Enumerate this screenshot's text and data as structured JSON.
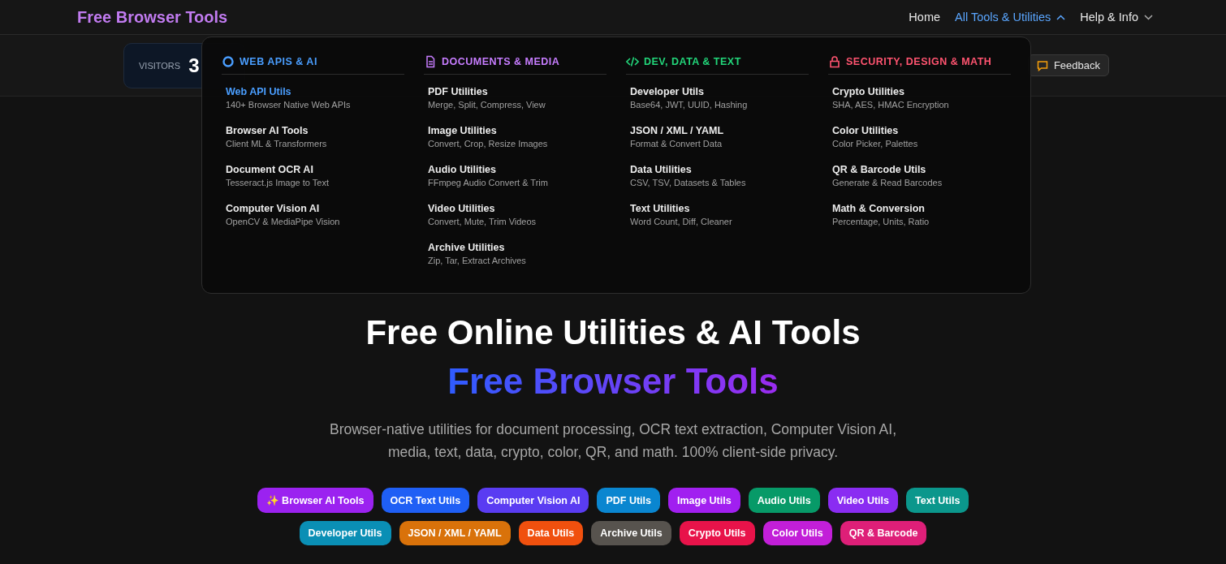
{
  "header": {
    "logo": "Free Browser Tools",
    "nav": [
      {
        "label": "Home",
        "kind": "link",
        "selected": false
      },
      {
        "label": "All Tools & Utilities",
        "kind": "dropdown",
        "selected": true,
        "expanded": true
      },
      {
        "label": "Help & Info",
        "kind": "dropdown",
        "selected": false,
        "expanded": false
      }
    ]
  },
  "stats": {
    "label": "VISITORS",
    "value": "3"
  },
  "feedback_button": "Feedback",
  "menu": {
    "sections": [
      {
        "title": "WEB APIS & AI",
        "color": "#4a9eff",
        "items": [
          {
            "title": "Web API Utils",
            "description": "140+ Browser Native Web APIs",
            "selected": true
          },
          {
            "title": "Browser AI Tools",
            "description": "Client ML & Transformers",
            "selected": false
          },
          {
            "title": "Document OCR AI",
            "description": "Tesseract.js Image to Text",
            "selected": false
          },
          {
            "title": "Computer Vision AI",
            "description": "OpenCV & MediaPipe Vision",
            "selected": false
          }
        ]
      },
      {
        "title": "DOCUMENTS & MEDIA",
        "color": "#c77dff",
        "items": [
          {
            "title": "PDF Utilities",
            "description": "Merge, Split, Compress, View",
            "selected": false
          },
          {
            "title": "Image Utilities",
            "description": "Convert, Crop, Resize Images",
            "selected": false
          },
          {
            "title": "Audio Utilities",
            "description": "FFmpeg Audio Convert & Trim",
            "selected": false
          },
          {
            "title": "Video Utilities",
            "description": "Convert, Mute, Trim Videos",
            "selected": false
          },
          {
            "title": "Archive Utilities",
            "description": "Zip, Tar, Extract Archives",
            "selected": false
          }
        ]
      },
      {
        "title": "DEV, DATA & TEXT",
        "color": "#22d67a",
        "items": [
          {
            "title": "Developer Utils",
            "description": "Base64, JWT, UUID, Hashing",
            "selected": false
          },
          {
            "title": "JSON / XML / YAML",
            "description": "Format & Convert Data",
            "selected": false
          },
          {
            "title": "Data Utilities",
            "description": "CSV, TSV, Datasets & Tables",
            "selected": false
          },
          {
            "title": "Text Utilities",
            "description": "Word Count, Diff, Cleaner",
            "selected": false
          }
        ]
      },
      {
        "title": "SECURITY, DESIGN & MATH",
        "color": "#ff5470",
        "items": [
          {
            "title": "Crypto Utilities",
            "description": "SHA, AES, HMAC Encryption",
            "selected": false
          },
          {
            "title": "Color Utilities",
            "description": "Color Picker, Palettes",
            "selected": false
          },
          {
            "title": "QR & Barcode Utils",
            "description": "Generate & Read Barcodes",
            "selected": false
          },
          {
            "title": "Math & Conversion",
            "description": "Percentage, Units, Ratio",
            "selected": false
          }
        ]
      }
    ]
  },
  "hero": {
    "title": "Free Online Utilities & AI Tools",
    "subtitle": "Free Browser Tools",
    "description": "Browser-native utilities for document processing, OCR text extraction, Computer Vision AI, media, text, data, crypto, color, QR, and math. 100% client-side privacy.",
    "tags": [
      {
        "label": "✨ Browser AI Tools",
        "color": "#9b22f0"
      },
      {
        "label": "OCR Text Utils",
        "color": "#1f5ff5"
      },
      {
        "label": "Computer Vision AI",
        "color": "#5a3cf2"
      },
      {
        "label": "PDF Utils",
        "color": "#0a86d0"
      },
      {
        "label": "Image Utils",
        "color": "#a11ff0"
      },
      {
        "label": "Audio Utils",
        "color": "#079a68"
      },
      {
        "label": "Video Utils",
        "color": "#8a2cf2"
      },
      {
        "label": "Text Utils",
        "color": "#0b978c"
      },
      {
        "label": "Developer Utils",
        "color": "#0a8fb5"
      },
      {
        "label": "JSON / XML / YAML",
        "color": "#d9720a"
      },
      {
        "label": "Data Utils",
        "color": "#f0500e"
      },
      {
        "label": "Archive Utils",
        "color": "#57534e"
      },
      {
        "label": "Crypto Utils",
        "color": "#e8134a"
      },
      {
        "label": "Color Utils",
        "color": "#c21fd8"
      },
      {
        "label": "QR & Barcode",
        "color": "#de1f78"
      }
    ]
  }
}
